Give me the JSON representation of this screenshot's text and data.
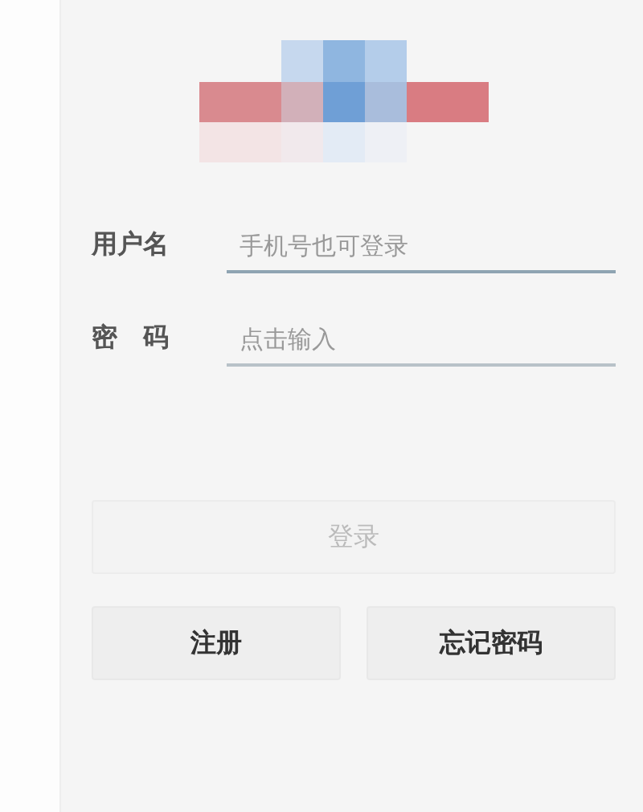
{
  "fields": [
    {
      "label": "用户名",
      "placeholder": "手机号也可登录",
      "focused": true
    },
    {
      "label": "密　码",
      "placeholder": "点击输入",
      "focused": false
    }
  ],
  "login_button": {
    "label": "登录",
    "disabled": true
  },
  "buttons": [
    {
      "label": "注册",
      "disabled": false
    },
    {
      "label": "忘记密码",
      "disabled": false
    }
  ]
}
